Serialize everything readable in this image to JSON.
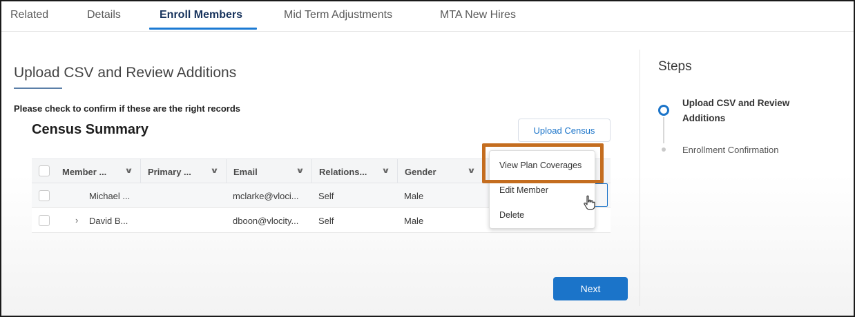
{
  "tabs": [
    {
      "label": "Related"
    },
    {
      "label": "Details"
    },
    {
      "label": "Enroll Members"
    },
    {
      "label": "Mid Term Adjustments"
    },
    {
      "label": "MTA New Hires"
    }
  ],
  "active_tab": "Enroll Members",
  "section": {
    "title": "Upload CSV and Review Additions",
    "confirm_text": "Please check to confirm if these are the right records"
  },
  "census": {
    "title": "Census Summary",
    "upload_label": "Upload Census"
  },
  "table": {
    "columns": [
      "Member ...",
      "Primary ...",
      "Email",
      "Relations...",
      "Gender"
    ],
    "rows": [
      {
        "member": "Michael ...",
        "primary": "",
        "email": "mclarke@vloci...",
        "relationship": "Self",
        "gender": "Male"
      },
      {
        "member": "David B...",
        "primary": "",
        "email": "dboon@vlocity...",
        "relationship": "Self",
        "gender": "Male"
      }
    ]
  },
  "row_menu": {
    "items": [
      "View Plan Coverages",
      "Edit Member",
      "Delete"
    ]
  },
  "next_label": "Next",
  "steps": {
    "title": "Steps",
    "items": [
      "Upload CSV and Review Additions",
      "Enrollment Confirmation"
    ]
  },
  "colors": {
    "accent": "#1b74c9",
    "highlight": "#c46d1f"
  },
  "icons": {
    "sort": "chevron-down-icon",
    "expand": "chevron-right-icon",
    "cursor": "hand-pointer-icon"
  }
}
